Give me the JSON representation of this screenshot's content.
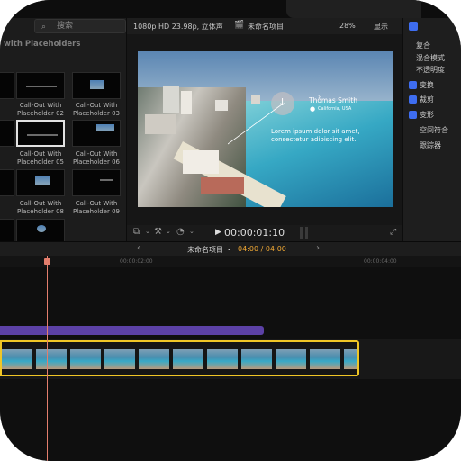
{
  "viewer": {
    "format": "1080p HD 23.98p, 立体声",
    "project_title": "未命名项目",
    "zoom": "28%",
    "display_label": "显示",
    "timecode": "00:00:01:10"
  },
  "browser": {
    "search_placeholder": "搜索",
    "category": "with Placeholders",
    "items": [
      {
        "label": "Call-Out With Placeholder 02"
      },
      {
        "label": "Call-Out With Placeholder 03"
      },
      {
        "label": "Call-Out With Placeholder 05"
      },
      {
        "label": "Call-Out With Placeholder 06"
      },
      {
        "label": "Call-Out With Placeholder 08"
      },
      {
        "label": "Call-Out With Placeholder 09"
      }
    ]
  },
  "callout": {
    "name": "Thomas Smith",
    "location": "California, USA",
    "body_line1": "Lorem ipsum dolor sit amet,",
    "body_line2": "consectetur adipiscing elit."
  },
  "inspector": {
    "items": [
      {
        "label": "复合",
        "checkbox": false
      },
      {
        "label": "混合模式",
        "checkbox": false
      },
      {
        "label": "不透明度",
        "checkbox": false
      },
      {
        "label": "变换",
        "checkbox": true
      },
      {
        "label": "裁剪",
        "checkbox": true
      },
      {
        "label": "变形",
        "checkbox": true
      },
      {
        "label": "空间符合",
        "checkbox": false
      },
      {
        "label": "跟踪器",
        "checkbox": false
      }
    ],
    "accent": "#3e6df0"
  },
  "timeline": {
    "project_title": "未命名项目",
    "duration": "04:00 / 04:00",
    "ruler_mark_1": "00:00:02:00",
    "ruler_mark_2": "00:00:04:00",
    "title_clip_color": "#5c41a6",
    "selection_color": "#f0c626",
    "playhead_color": "#e37e6d"
  }
}
